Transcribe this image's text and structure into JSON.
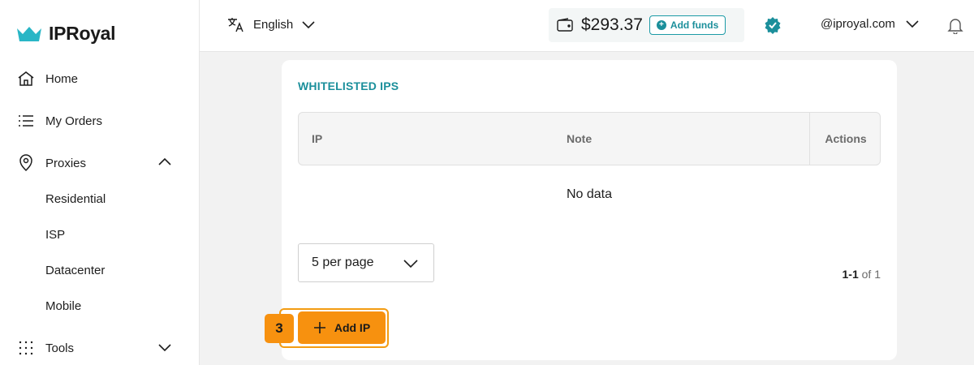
{
  "brand": {
    "name": "IPRoyal",
    "accent": "#1b8f9b",
    "orange": "#f7910f"
  },
  "sidebar": {
    "items": [
      {
        "label": "Home",
        "icon": "home-icon"
      },
      {
        "label": "My Orders",
        "icon": "list-icon"
      },
      {
        "label": "Proxies",
        "icon": "location-pin-icon",
        "expanded": true
      },
      {
        "label": "Tools",
        "icon": "grid-dots-icon",
        "expanded": false
      }
    ],
    "proxies_sub": [
      "Residential",
      "ISP",
      "Datacenter",
      "Mobile"
    ]
  },
  "header": {
    "language": "English",
    "balance": "$293.37",
    "add_funds": "Add funds",
    "account": "@iproyal.com"
  },
  "whitelist": {
    "title": "WHITELISTED IPS",
    "columns": [
      "IP",
      "Note",
      "Actions"
    ],
    "empty_text": "No data",
    "per_page": "5 per page",
    "pagination_range": "1-1",
    "pagination_total": "of 1",
    "add_button": "Add IP",
    "step_badge": "3"
  }
}
